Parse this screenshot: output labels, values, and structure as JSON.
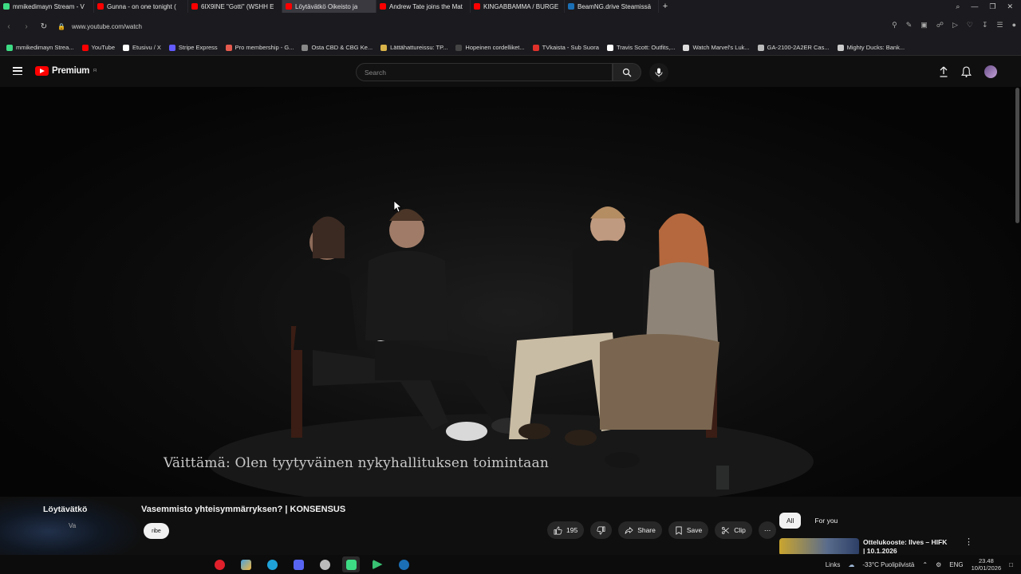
{
  "browser": {
    "tabs": [
      {
        "label": "mmikedimayn Stream - V",
        "color": "#3ddc84",
        "active": false
      },
      {
        "label": "Gunna - on one tonight (",
        "color": "#ff0000",
        "active": false
      },
      {
        "label": "6IX9INE \"Gotti\" (WSHH E",
        "color": "#ff0000",
        "active": false
      },
      {
        "label": "Löytävätkö Oikeisto ja",
        "color": "#ff0000",
        "active": true
      },
      {
        "label": "Andrew Tate joins the Mat",
        "color": "#ff0000",
        "active": false
      },
      {
        "label": "KINGABBAMMA / BURGE",
        "color": "#ff0000",
        "active": false
      },
      {
        "label": "BeamNG.drive Steamissä",
        "color": "#1b6fb5",
        "active": false
      }
    ],
    "new_tab": "+",
    "url": "www.youtube.com/watch",
    "bookmarks": [
      {
        "label": "mmikedimayn Strea...",
        "color": "#3ddc84"
      },
      {
        "label": "YouTube",
        "color": "#ff0000"
      },
      {
        "label": "Etusivu / X",
        "color": "#ffffff"
      },
      {
        "label": "Stripe Express",
        "color": "#635bff"
      },
      {
        "label": "Pro membership - G...",
        "color": "#e55a4e"
      },
      {
        "label": "Osta CBD & CBG Ke...",
        "color": "#888888"
      },
      {
        "label": "Lättähattureissu: TP...",
        "color": "#d8b34a"
      },
      {
        "label": "Hopeinen cordelliket...",
        "color": "#444444"
      },
      {
        "label": "TVkaista - Sub Suora",
        "color": "#e0312b"
      },
      {
        "label": "Travis Scott: Outfits,...",
        "color": "#ffffff"
      },
      {
        "label": "Watch Marvel's Luk...",
        "color": "#dddddd"
      },
      {
        "label": "GA-2100-2A2ER Cas...",
        "color": "#bbbbbb"
      },
      {
        "label": "Mighty Ducks: Bank...",
        "color": "#cccccc"
      }
    ]
  },
  "youtube": {
    "logo_text": "Premium",
    "logo_region": "FI",
    "search_placeholder": "Search",
    "video": {
      "subtitle": "Väittämä: Olen tyytyväinen nykyhallituksen toimintaan",
      "title": "Vasemmisto yhteisymmärryksen? | KONSENSUS",
      "channel": "Löytävätkö",
      "channel_sub": "Va",
      "subscribe_label": "ribe",
      "likes": "195",
      "share_label": "Share",
      "save_label": "Save",
      "clip_label": "Clip"
    },
    "chips": [
      "All",
      "For you"
    ],
    "recommendation": {
      "title": "Ottelukooste: Ilves – HIFK | 10.1.2026"
    }
  },
  "taskbar": {
    "apps": [
      {
        "name": "opera",
        "color": "#e0202b"
      },
      {
        "name": "copilot",
        "color": "#4aa3df"
      },
      {
        "name": "edge",
        "color": "#1fa2d8"
      },
      {
        "name": "discord",
        "color": "#5865f2"
      },
      {
        "name": "shield",
        "color": "#bbbbbb"
      },
      {
        "name": "android-studio",
        "color": "#3ddc84"
      },
      {
        "name": "player",
        "color": "#38c172"
      },
      {
        "name": "steam",
        "color": "#1b6fb5"
      }
    ],
    "links_label": "Links",
    "weather": "-33°C  Puolipilvistä",
    "language": "ENG",
    "time": "23.48",
    "date": "10/01/2026"
  }
}
